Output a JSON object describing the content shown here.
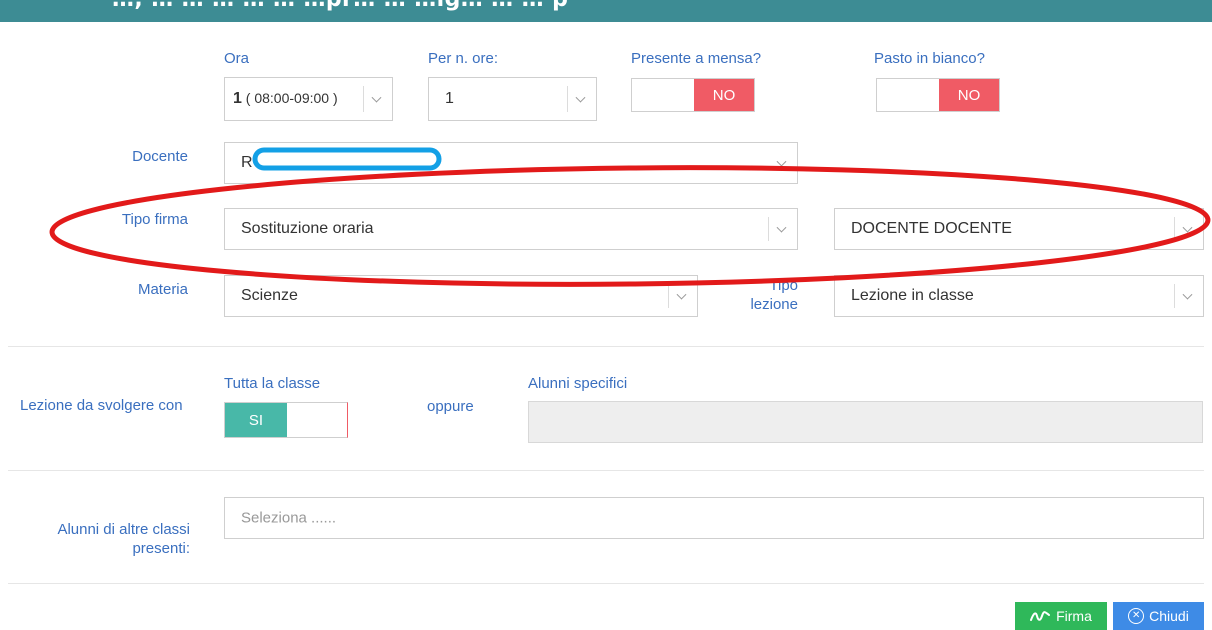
{
  "banner": {
    "text": "…, … … … … … …pr… … …ig… … … p"
  },
  "fields": {
    "ora": {
      "label": "Ora",
      "value_bold": "1",
      "value_rest": " ( 08:00-09:00 )"
    },
    "per_ore": {
      "label": "Per n. ore:",
      "value": "1"
    },
    "mensa": {
      "label": "Presente a mensa?",
      "value": "NO"
    },
    "pasto": {
      "label": "Pasto in bianco?",
      "value": "NO"
    },
    "docente": {
      "label": "Docente",
      "value": "R"
    },
    "tipo_firma": {
      "label": "Tipo firma",
      "value": "Sostituzione oraria",
      "secondary_value": "DOCENTE DOCENTE"
    },
    "materia": {
      "label": "Materia",
      "value": "Scienze"
    },
    "tipo_lezione": {
      "label_line1": "Tipo",
      "label_line2": "lezione",
      "value": "Lezione in classe"
    }
  },
  "lezione": {
    "label": "Lezione da svolgere con",
    "tutta_label": "Tutta la classe",
    "tutta_value": "SI",
    "oppure": "oppure",
    "alunni_label": "Alunni specifici"
  },
  "altre": {
    "label_line1": "Alunni di altre classi",
    "label_line2": "presenti:",
    "placeholder": "Seleziona ......"
  },
  "buttons": {
    "firma": "Firma",
    "chiudi": "Chiudi"
  },
  "colors": {
    "header_teal": "#3d8c94",
    "label_blue": "#3a6fbf",
    "no_red": "#f05b65",
    "si_teal": "#48b8a8",
    "firma_green": "#2fb85a",
    "chiudi_blue": "#3e8be6",
    "annotation_red": "#e21a1a",
    "annotation_blue": "#13a0e6"
  }
}
